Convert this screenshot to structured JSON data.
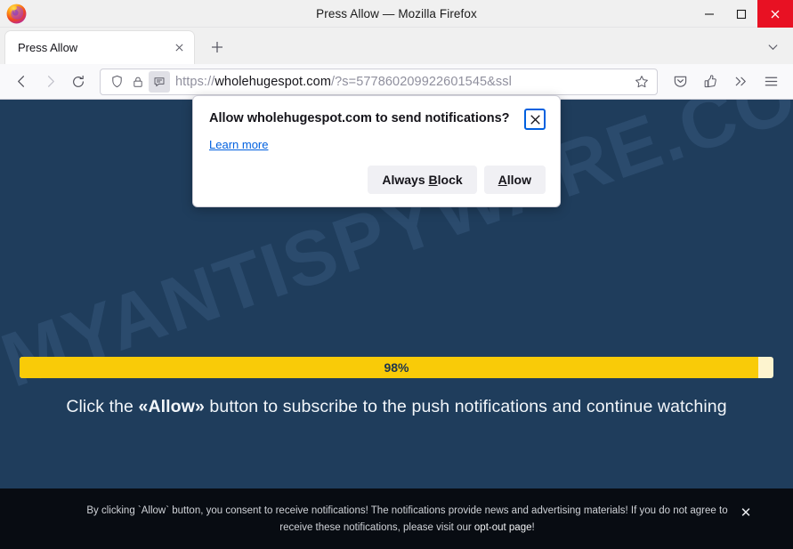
{
  "window": {
    "title": "Press Allow — Mozilla Firefox",
    "minimize_label": "Minimize",
    "maximize_label": "Maximize",
    "close_label": "Close"
  },
  "tabs": {
    "items": [
      {
        "label": "Press Allow",
        "close_label": "Close tab"
      }
    ],
    "new_tab_label": "New tab",
    "list_all_tabs_label": "List all tabs"
  },
  "navbar": {
    "back_label": "Go back one page",
    "forward_label": "Go forward one page",
    "reload_label": "Reload current page",
    "shield_label": "tracking-protection-shield",
    "lock_label": "connection-secure-lock",
    "permission_label": "notification-permission-indicator",
    "url_scheme": "https://",
    "url_domain": "wholehugespot.com",
    "url_path": "/?s=577860209922601545&ssl",
    "bookmark_label": "Bookmark this page",
    "pocket_label": "Save to Pocket",
    "share_label": "Share this page",
    "overflow_label": "More tools",
    "menu_label": "Open application menu"
  },
  "permission_popup": {
    "title": "Allow wholehugespot.com to send notifications?",
    "close_label": "Close",
    "learn_more": "Learn more",
    "always_block": {
      "prefix": "Always ",
      "accel": "B",
      "suffix": "lock"
    },
    "allow": {
      "prefix": "",
      "accel": "A",
      "suffix": "llow"
    }
  },
  "page_content": {
    "watermark": "MYANTISPYWARE.COM",
    "progress": {
      "percent": 98,
      "label": "98%",
      "fill_color": "#f9cb08",
      "track_color": "#fdf4cf"
    },
    "cta_before": "Click the ",
    "cta_strong": "«Allow»",
    "cta_after": " button to subscribe to the push notifications and continue watching",
    "background_color": "#1f3d5c"
  },
  "consent_banner": {
    "line1": "By clicking `Allow` button, you consent to receive notifications! The notifications provide news and advertising materials! If you do not agree to",
    "line2_before": "receive these notifications, please visit our ",
    "line2_link": "opt-out page",
    "line2_after": "!",
    "close_label": "✕",
    "background_color": "#080c12"
  }
}
